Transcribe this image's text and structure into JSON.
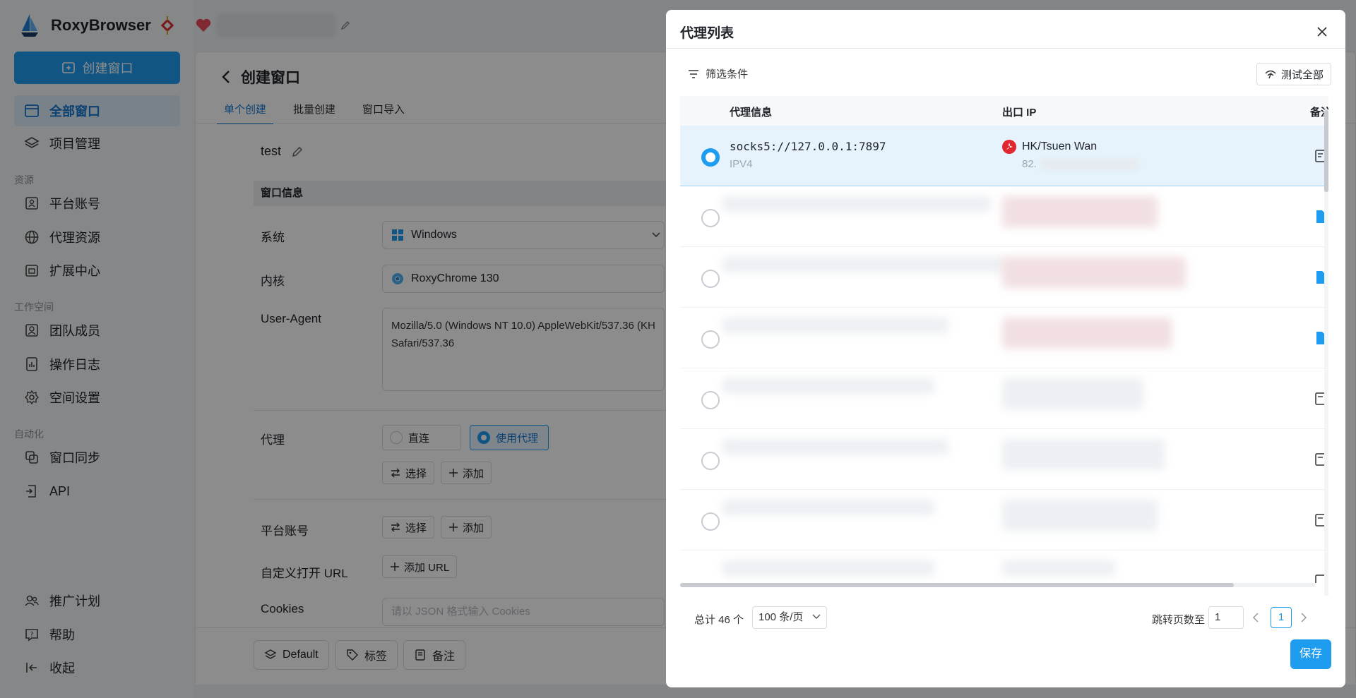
{
  "app": {
    "name": "RoxyBrowser"
  },
  "sidebar": {
    "create_button": "创建窗口",
    "items": [
      {
        "label": "全部窗口",
        "icon": "window-icon",
        "active": true
      },
      {
        "label": "项目管理",
        "icon": "layers-icon"
      }
    ],
    "group_resources": "资源",
    "resources": [
      {
        "label": "平台账号",
        "icon": "account-icon"
      },
      {
        "label": "代理资源",
        "icon": "globe-icon"
      },
      {
        "label": "扩展中心",
        "icon": "extension-icon"
      }
    ],
    "group_workspace": "工作空间",
    "workspace": [
      {
        "label": "团队成员",
        "icon": "team-icon"
      },
      {
        "label": "操作日志",
        "icon": "log-icon"
      },
      {
        "label": "空间设置",
        "icon": "gear-icon"
      }
    ],
    "group_automation": "自动化",
    "automation": [
      {
        "label": "窗口同步",
        "icon": "sync-icon"
      },
      {
        "label": "API",
        "icon": "api-icon"
      }
    ],
    "bottom": [
      {
        "label": "推广计划",
        "icon": "users-icon"
      },
      {
        "label": "帮助",
        "icon": "help-icon"
      },
      {
        "label": "收起",
        "icon": "collapse-icon"
      }
    ]
  },
  "main": {
    "title": "创建窗口",
    "tabs": [
      "单个创建",
      "批量创建",
      "窗口导入"
    ],
    "window_name": "test",
    "section_title": "窗口信息",
    "labels": {
      "system": "系统",
      "kernel": "内核",
      "user_agent": "User-Agent",
      "proxy": "代理",
      "platform_account": "平台账号",
      "custom_url": "自定义打开 URL",
      "cookies": "Cookies"
    },
    "system_value": "Windows",
    "kernel_value": "RoxyChrome 130",
    "user_agent_line1": "Mozilla/5.0 (Windows NT 10.0) AppleWebKit/537.36 (KH",
    "user_agent_line2": "Safari/537.36",
    "proxy_direct": "直连",
    "proxy_use": "使用代理",
    "select_btn": "选择",
    "add_btn": "添加",
    "add_url_btn": "添加 URL",
    "cookies_placeholder": "请以 JSON 格式输入 Cookies",
    "footer": {
      "default_label": "Default",
      "tag_label": "标签",
      "note_label": "备注"
    }
  },
  "modal": {
    "title": "代理列表",
    "filter_label": "筛选条件",
    "test_all_label": "测试全部",
    "columns": {
      "proxy_info": "代理信息",
      "exit_ip": "出口 IP",
      "note": "备注"
    },
    "selected_row": {
      "proxy": "socks5://127.0.0.1:7897",
      "type": "IPV4",
      "location": "HK/Tsuen Wan",
      "ip_prefix": "82."
    },
    "pagination": {
      "total": "总计 46 个",
      "page_size": "100 条/页",
      "jump_label": "跳转页数至",
      "jump_value": "1",
      "current_page": "1"
    },
    "save_label": "保存"
  },
  "colors": {
    "accent": "#1e9cf0",
    "active_bg": "#dcebfa",
    "selected_row_bg": "#e6f3fd"
  }
}
